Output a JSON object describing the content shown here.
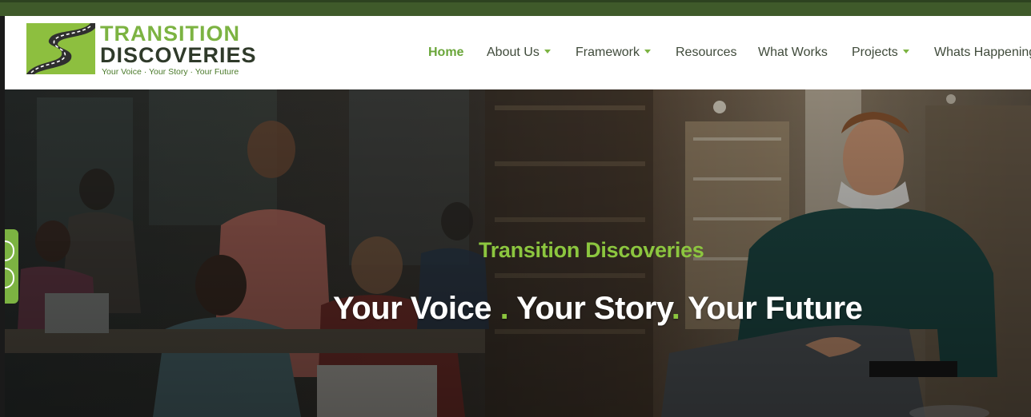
{
  "brand": {
    "line1": "TRANSITION",
    "line2": "DISCOVERIES",
    "tagline": "Your Voice · Your Story · Your Future"
  },
  "nav": {
    "items": [
      {
        "label": "Home",
        "active": true,
        "dropdown": false
      },
      {
        "label": "About Us",
        "active": false,
        "dropdown": true
      },
      {
        "label": "Framework",
        "active": false,
        "dropdown": true
      },
      {
        "label": "Resources",
        "active": false,
        "dropdown": false
      },
      {
        "label": "What Works",
        "active": false,
        "dropdown": false
      },
      {
        "label": "Projects",
        "active": false,
        "dropdown": true
      },
      {
        "label": "Whats Happening",
        "active": false,
        "dropdown": false
      }
    ]
  },
  "hero": {
    "subtitle": "Transition Discoveries",
    "title_parts": [
      "Your Voice ",
      ". ",
      "Your Story",
      ". ",
      "Your Future"
    ]
  },
  "colors": {
    "accent_green": "#7cb342",
    "dark_green": "#3f5a2a",
    "nav_text": "#3f4a3a"
  }
}
